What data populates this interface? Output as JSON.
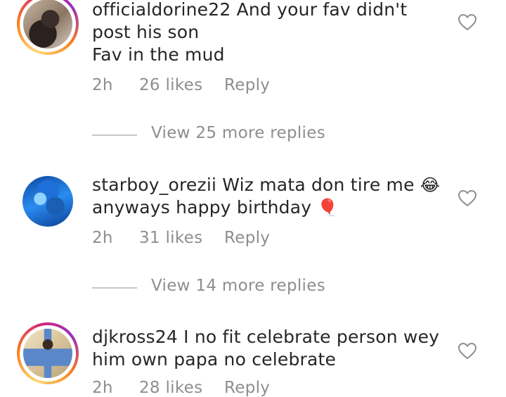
{
  "comments": [
    {
      "username": "officialdorine22",
      "text": "And your fav didn't post his son",
      "text2": "Fav in the mud",
      "time": "2h",
      "likes": "26 likes",
      "reply": "Reply",
      "has_story_ring": true
    },
    {
      "username": "starboy_orezii",
      "text": "Wiz mata don tire me",
      "emoji1": "😂",
      "text2": "anyways happy birthday",
      "emoji2": "🎈",
      "time": "2h",
      "likes": "31 likes",
      "reply": "Reply",
      "has_story_ring": false
    },
    {
      "username": "djkross24",
      "text": "I no fit celebrate person wey him own papa no celebrate",
      "time": "2h",
      "likes": "28 likes",
      "reply": "Reply",
      "has_story_ring": true
    }
  ],
  "view_replies": [
    {
      "label": "View 25 more replies"
    },
    {
      "label": "View 14 more replies"
    }
  ],
  "colors": {
    "text": "#262626",
    "secondary": "#8e8e8e",
    "divider": "#c7c7c7"
  },
  "icons": {
    "like": "heart-outline-icon"
  }
}
